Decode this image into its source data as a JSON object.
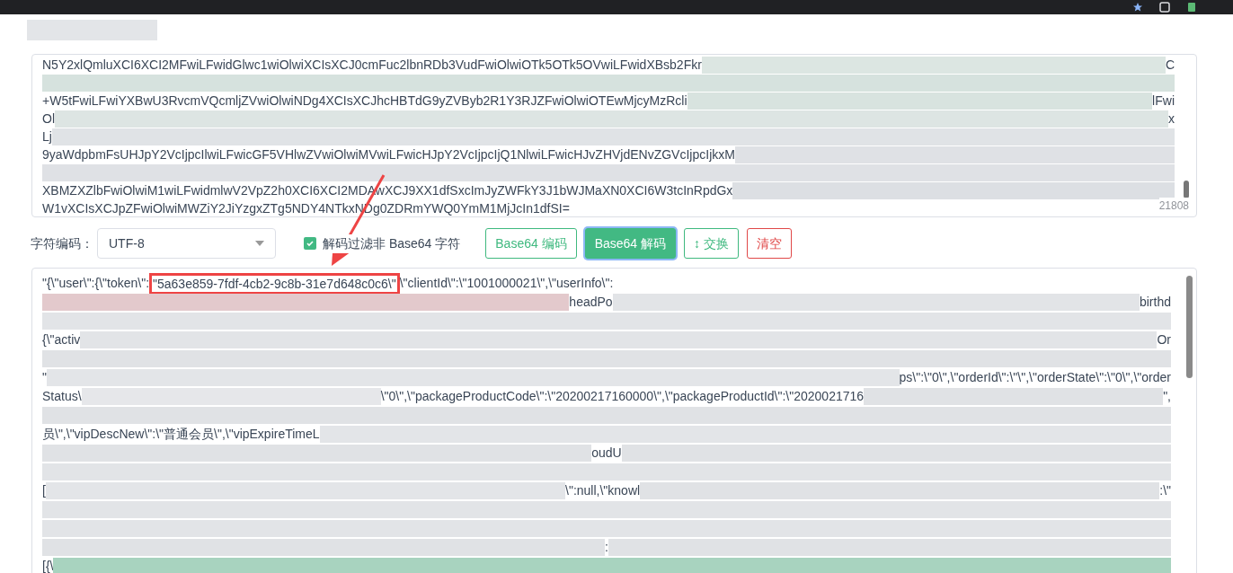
{
  "input": {
    "lines": [
      {
        "segments": [
          {
            "kind": "text",
            "text": "N5Y2xlQmluXCI6XCI2MFwiLFwidGlwc1wiOlwiXCIsXCJ0cmFuc2lbnRDb3VudFwiOlwiOTk5OTk5OVwiLFwidXBsb2Fkr"
          },
          {
            "kind": "redacted",
            "color": "#dce6e2"
          },
          {
            "kind": "text",
            "text": "C"
          }
        ]
      },
      {
        "segments": [
          {
            "kind": "redacted",
            "color": "#d6e2de"
          }
        ]
      },
      {
        "segments": [
          {
            "kind": "text",
            "text": "+W5tFwiLFwiYXBwU3RvcmVQcmljZVwiOlwiNDg4XCIsXCJhcHBTdG9yZVByb2R1Y3RJZFwiOlwiOTEwMjcyMzRcli"
          },
          {
            "kind": "redacted",
            "color": "#d8e3df"
          },
          {
            "kind": "text",
            "text": "lFwi"
          }
        ]
      },
      {
        "segments": [
          {
            "kind": "text",
            "text": "Ol"
          },
          {
            "kind": "redacted",
            "color": "#dde5e3"
          },
          {
            "kind": "text",
            "text": "x"
          }
        ]
      },
      {
        "segments": [
          {
            "kind": "text",
            "text": "Lj"
          },
          {
            "kind": "redacted",
            "color": "#e0e3e6"
          }
        ]
      },
      {
        "segments": [
          {
            "kind": "text",
            "text": "9yaWdpbmFsUHJpY2VcIjpcIlwiLFwicGF5VHlwZVwiOlwiMVwiLFwicHJpY2VcIjpcIjQ1NlwiLFwicHJvZHVjdENvZGVcIjpcIjkxM"
          },
          {
            "kind": "redacted",
            "color": "#dfe1e5"
          }
        ]
      },
      {
        "segments": [
          {
            "kind": "redacted",
            "color": "#dfe1e5"
          }
        ]
      },
      {
        "segments": [
          {
            "kind": "text",
            "text": "XBMZXZlbFwiOlwiM1wiLFwidmlwV2VpZ2h0XCI6XCI2MDAwXCJ9XX1dfSxcImJyZWFkY3J1bWJMaXN0XCI6W3tcInRpdGx"
          },
          {
            "kind": "redacted",
            "color": "#dcdfe3"
          }
        ]
      },
      {
        "segments": [
          {
            "kind": "text",
            "text": "W1vXCIsXCJpZFwiOlwiMWZiY2JiYzgxZTg5NDY4NTkxNDg0ZDRmYWQ0YmM1MjJcIn1dfSI="
          }
        ]
      }
    ],
    "counter": "21808"
  },
  "encoding": {
    "label": "字符编码：",
    "value": "UTF-8"
  },
  "filter_option": {
    "label": "解码过滤非 Base64 字符",
    "checked": true
  },
  "buttons": [
    {
      "label": "Base64 编码",
      "kind": "outline"
    },
    {
      "label": "Base64 解码",
      "kind": "primary"
    },
    {
      "label": "↕ 交换",
      "kind": "outline"
    },
    {
      "label": "清空",
      "kind": "danger"
    }
  ],
  "output": {
    "lines": [
      {
        "segments": [
          {
            "kind": "text",
            "text": "\"{\\\"user\\\":{\\\"token\\\":"
          },
          {
            "kind": "highlight",
            "text": "\"5a63e859-7fdf-4cb2-9c8b-31e7d648c0c6\\\""
          },
          {
            "kind": "text",
            "text": "\\\"clientId\\\":\\\"1001000021\\\",\\\"userInfo\\\":"
          }
        ]
      },
      {
        "segments": [
          {
            "kind": "redacted",
            "color": "#e3c9cc"
          },
          {
            "kind": "text",
            "text": "headPo"
          },
          {
            "kind": "redacted",
            "color": "#e2e4e7"
          },
          {
            "kind": "text",
            "text": "birthd"
          }
        ]
      },
      {
        "segments": [
          {
            "kind": "redacted",
            "color": "#e2e4e7"
          }
        ]
      },
      {
        "segments": [
          {
            "kind": "text",
            "text": "{\\\"activ"
          },
          {
            "kind": "redacted",
            "color": "#e2e4e7"
          },
          {
            "kind": "text",
            "text": "Or"
          }
        ]
      },
      {
        "segments": [
          {
            "kind": "redacted",
            "color": "#e0e2e5"
          }
        ]
      },
      {
        "segments": [
          {
            "kind": "text",
            "text": "\""
          },
          {
            "kind": "redacted",
            "color": "#e3e5e8"
          },
          {
            "kind": "text",
            "text": "ps\\\":\\\"0\\\",\\\"orderId\\\":\\\"\\\",\\\"orderState\\\":\\\"0\\\",\\\"order"
          }
        ]
      },
      {
        "segments": [
          {
            "kind": "text",
            "text": "Status\\"
          },
          {
            "kind": "redacted",
            "color": "#e6e7ea"
          },
          {
            "kind": "text",
            "text": "\\\"0\\\",\\\"packageProductCode\\\":\\\"20200217160000\\\",\\\"packageProductId\\\":\\\"2020021716"
          },
          {
            "kind": "redacted",
            "color": "#e0e2e5"
          },
          {
            "kind": "text",
            "text": "\","
          }
        ]
      },
      {
        "segments": [
          {
            "kind": "redacted",
            "color": "#e0e2e5"
          }
        ]
      },
      {
        "segments": [
          {
            "kind": "text",
            "text": "员\\\",\\\"vipDescNew\\\":\\\"普通会员\\\",\\\"vipExpireTimeL"
          },
          {
            "kind": "redacted",
            "color": "#e3e5e8"
          }
        ]
      },
      {
        "segments": [
          {
            "kind": "redacted",
            "color": "#e0e2e5"
          },
          {
            "kind": "text",
            "text": "oudU"
          },
          {
            "kind": "redacted",
            "color": "#e0e2e5"
          }
        ]
      },
      {
        "segments": [
          {
            "kind": "redacted",
            "color": "#e2e4e7"
          }
        ]
      },
      {
        "segments": [
          {
            "kind": "text",
            "text": "["
          },
          {
            "kind": "redacted",
            "color": "#e3e5e8"
          },
          {
            "kind": "text",
            "text": "\\\":null,\\\"knowl"
          },
          {
            "kind": "redacted",
            "color": "#e0e2e5"
          },
          {
            "kind": "text",
            "text": ":\\\""
          }
        ]
      },
      {
        "segments": [
          {
            "kind": "redacted",
            "color": "#e2e4e7"
          }
        ]
      },
      {
        "segments": [
          {
            "kind": "redacted",
            "color": "#e2e4e7"
          }
        ]
      },
      {
        "segments": [
          {
            "kind": "redacted",
            "color": "#e0e2e5"
          },
          {
            "kind": "text",
            "text": ":"
          },
          {
            "kind": "redacted",
            "color": "#e0e2e5"
          }
        ]
      },
      {
        "segments": [
          {
            "kind": "text",
            "text": "[{\\"
          },
          {
            "kind": "redacted",
            "color": "#a8d3bf"
          }
        ]
      }
    ]
  }
}
